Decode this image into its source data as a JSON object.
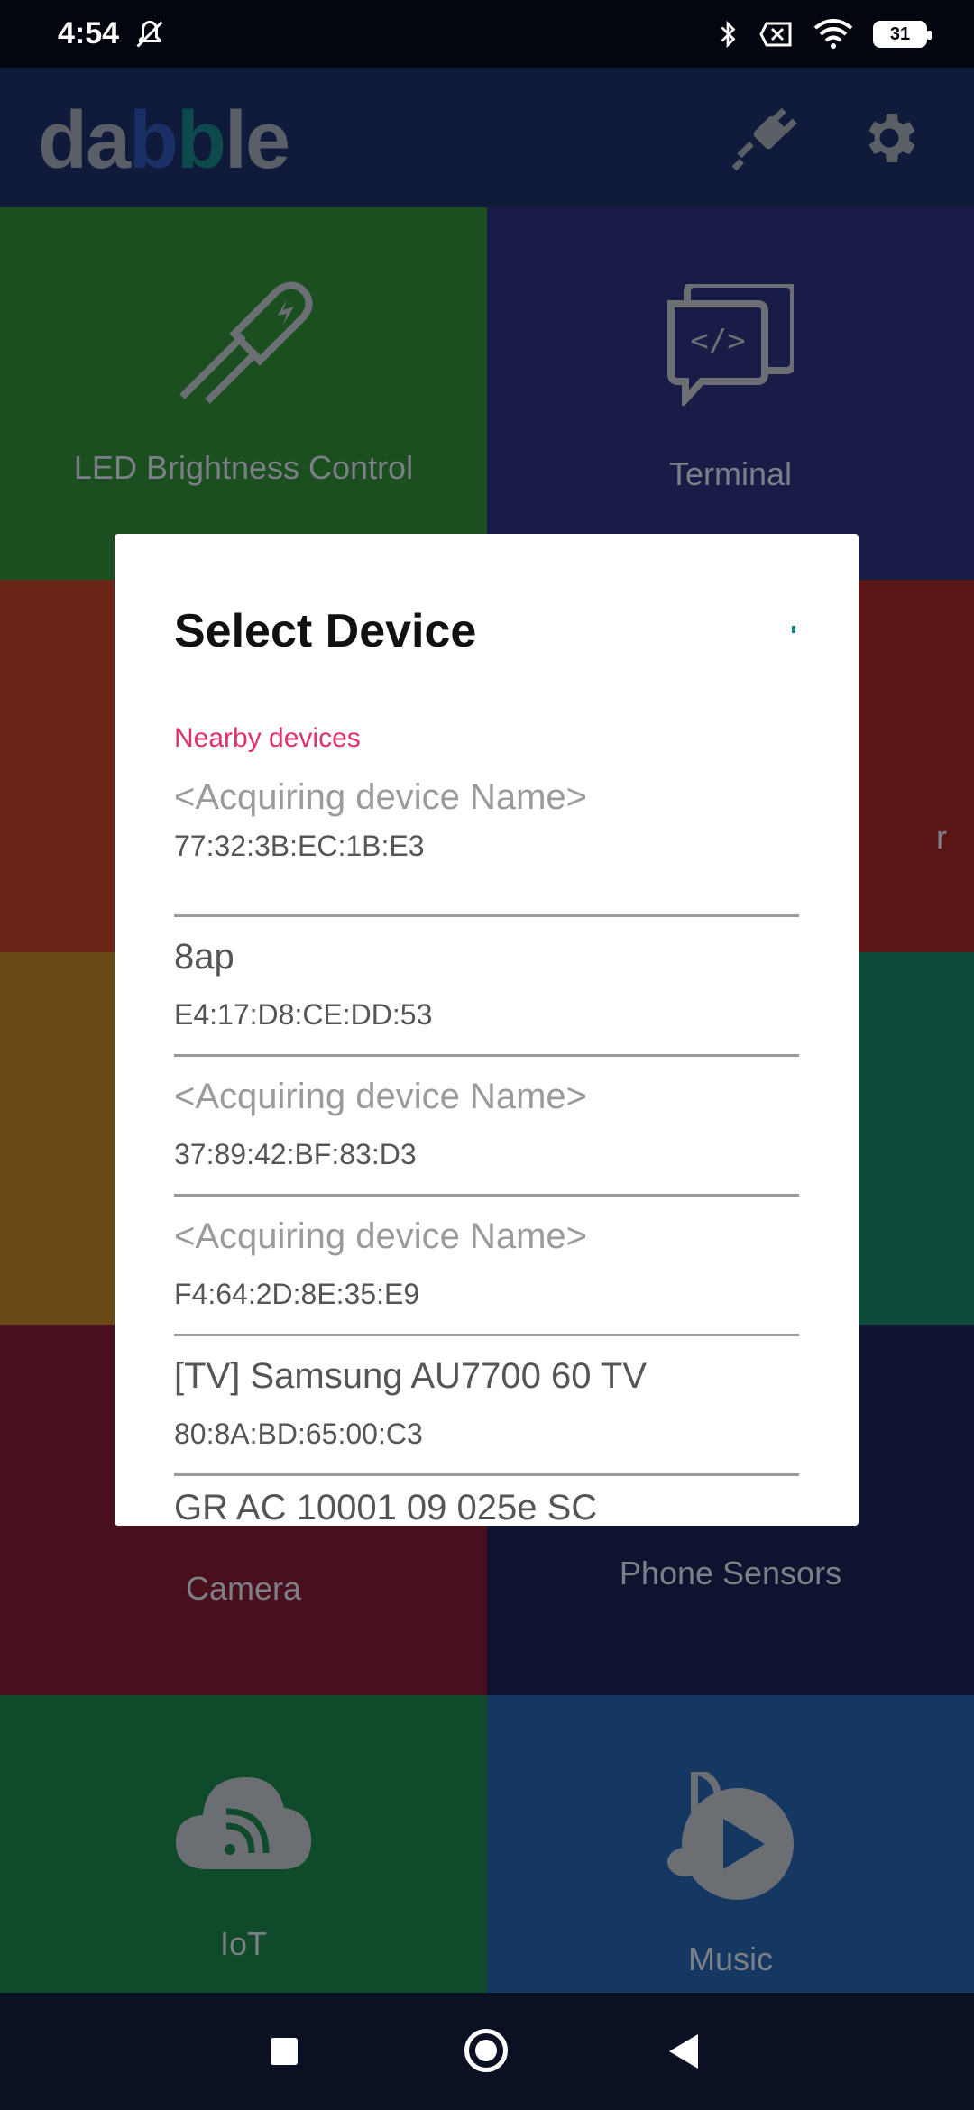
{
  "status_bar": {
    "time": "4:54",
    "battery": "31"
  },
  "app_bar": {
    "logo_text": "dabble"
  },
  "tiles": {
    "led": "LED Brightness Control",
    "terminal": "Terminal",
    "camera": "Camera",
    "phone_sensors": "Phone Sensors",
    "iot": "IoT",
    "music": "Music",
    "partial_right": "r"
  },
  "dialog": {
    "title": "Select Device",
    "section": "Nearby devices",
    "devices": [
      {
        "name": "<Acquiring device Name>",
        "address": "77:32:3B:EC:1B:E3"
      },
      {
        "name": "8ap",
        "address": "E4:17:D8:CE:DD:53"
      },
      {
        "name": "<Acquiring device Name>",
        "address": "37:89:42:BF:83:D3"
      },
      {
        "name": "<Acquiring device Name>",
        "address": "F4:64:2D:8E:35:E9"
      },
      {
        "name": "[TV] Samsung AU7700 60 TV",
        "address": "80:8A:BD:65:00:C3"
      }
    ],
    "partial_device": "GR AC 10001 09 025e SC"
  },
  "colors": {
    "accent": "#e0316f",
    "spinner": "#16857a"
  }
}
